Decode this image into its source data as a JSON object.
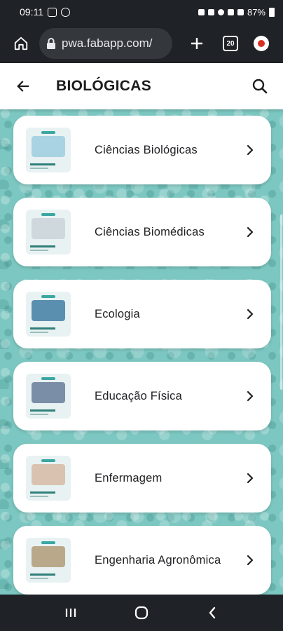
{
  "status_bar": {
    "time": "09:11",
    "battery": "87%"
  },
  "browser": {
    "url": "pwa.fabapp.com/",
    "tab_count": "20"
  },
  "header": {
    "title": "BIOLÓGICAS"
  },
  "courses": [
    {
      "label": "Ciências Biológicas",
      "art_color": "#a9d3e3"
    },
    {
      "label": "Ciências Biomédicas",
      "art_color": "#cfd8dc"
    },
    {
      "label": "Ecologia",
      "art_color": "#5b8fb0"
    },
    {
      "label": "Educação Física",
      "art_color": "#7a8ea8"
    },
    {
      "label": "Enfermagem",
      "art_color": "#d9c2b0"
    },
    {
      "label": "Engenharia Agronômica",
      "art_color": "#b9a98a"
    }
  ],
  "colors": {
    "accent": "#3aa7a0",
    "background_texture": "#7cc7c1"
  }
}
